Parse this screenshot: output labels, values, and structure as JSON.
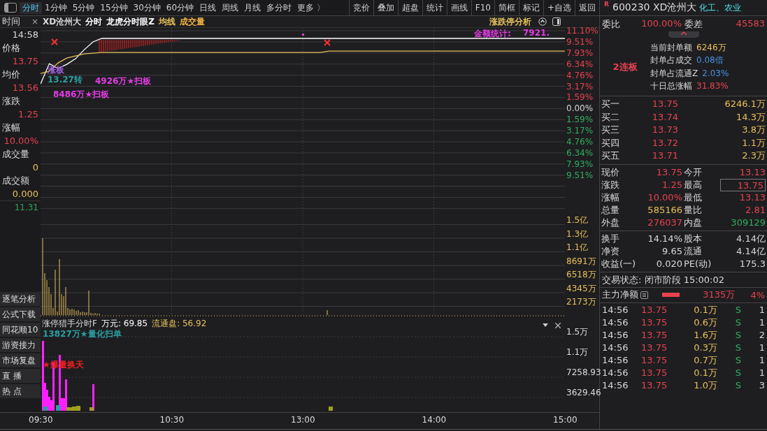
{
  "toolbar": {
    "tabs": [
      {
        "label": "分时",
        "selected": true
      },
      {
        "label": "1分钟",
        "selected": false
      },
      {
        "label": "5分钟",
        "selected": false
      },
      {
        "label": "15分钟",
        "selected": false
      },
      {
        "label": "30分钟",
        "selected": false
      },
      {
        "label": "60分钟",
        "selected": false
      },
      {
        "label": "日线",
        "selected": false
      },
      {
        "label": "周线",
        "selected": false
      },
      {
        "label": "月线",
        "selected": false
      },
      {
        "label": "多分时",
        "selected": false
      },
      {
        "label": "更多 〉",
        "selected": false
      }
    ],
    "buttons": [
      "竞价",
      "叠加",
      "超盘",
      "统计",
      "画线",
      "F10",
      "简框",
      "标记",
      "+自选",
      "返回"
    ]
  },
  "left_panel": {
    "title": "时间",
    "close": "×",
    "fields": [
      {
        "value": "14:58",
        "color": "#d8d8d8"
      },
      {
        "label": "价格",
        "value": "13.75",
        "color": "#e8424f"
      },
      {
        "label": "均价",
        "value": "13.56",
        "color": "#e8424f"
      },
      {
        "label": "涨跌",
        "value": "1.25",
        "color": "#e8424f"
      },
      {
        "label": "涨幅",
        "value": "10.00%",
        "color": "#e8424f"
      },
      {
        "label": "成交量",
        "value": "0",
        "color": "#e6c15a"
      },
      {
        "label": "成交额",
        "value": "0.000",
        "color": "#e6c15a"
      }
    ],
    "low_price": "11.31",
    "side_buttons": [
      "逐笔分析",
      "公式下载",
      "同花顺10",
      "游资接力",
      "市场复盘",
      "直 播",
      "热 点"
    ]
  },
  "chart_header": {
    "items": [
      {
        "text": "XD沧州大",
        "color": "#d8d8d8"
      },
      {
        "text": "分时",
        "color": "#ffffff"
      },
      {
        "text": "龙虎分时眼Z",
        "color": "#ffffff"
      },
      {
        "text": "均线",
        "color": "#e6c15a"
      },
      {
        "text": "成交量",
        "color": "#f0b040"
      }
    ],
    "analysis": "涨跌停分析"
  },
  "price_chart": {
    "chart_data": {
      "type": "line",
      "categories": [
        null,
        null,
        null,
        null,
        null,
        null,
        null,
        null,
        null,
        null,
        null,
        null,
        null,
        null,
        null,
        null,
        null,
        null,
        null,
        null,
        null,
        null,
        null,
        null,
        null,
        null,
        null,
        null,
        null,
        null,
        null,
        null,
        null,
        null,
        null,
        null,
        null,
        null,
        null,
        null,
        null,
        null,
        null,
        null,
        null,
        null,
        null,
        null,
        null,
        null,
        null,
        null,
        null,
        null,
        null,
        null,
        null,
        null,
        null,
        null,
        null
      ],
      "ylim": [
        -11.1,
        11.1
      ],
      "grid": true,
      "series": [
        {
          "color": "#ffffff",
          "values": [
            3.5,
            6.4,
            5.7,
            6.3,
            7.1,
            8.4,
            9.5,
            10.0,
            10.0,
            10.0,
            10.0,
            10.0,
            10.0,
            10.0,
            10.0,
            10.0,
            10.0,
            10.0,
            10.0,
            10.0,
            10.0,
            10.0,
            10.0,
            10.0,
            10.0,
            10.0,
            10.0,
            10.0,
            10.0,
            10.0,
            10.0,
            10.0,
            10.0,
            10.0,
            10.0,
            10.0,
            10.0,
            10.0,
            10.0,
            10.0,
            10.0,
            10.0,
            10.0,
            10.0,
            10.0,
            10.0,
            10.0,
            10.0,
            10.0,
            10.0,
            10.0,
            10.0,
            10.0,
            10.0,
            10.0,
            10.0,
            10.0,
            10.0,
            10.0,
            10.0,
            10.0
          ]
        },
        {
          "color": "#e6c15a",
          "values": [
            5.0,
            5.3,
            6.5,
            7.2,
            7.5,
            7.8,
            7.9,
            8.0,
            8.0,
            8.0,
            8.0,
            8.0,
            8.0,
            8.0,
            8.0,
            8.0,
            8.0,
            8.0,
            8.0,
            8.0,
            8.0,
            8.0,
            8.0,
            8.0,
            8.0,
            8.0,
            8.0,
            8.0,
            8.0,
            8.0,
            8.0,
            8.0,
            8.0,
            8.2,
            8.2,
            8.2,
            8.2,
            8.2,
            8.2,
            8.2,
            8.2,
            8.2,
            8.2,
            8.2,
            8.2,
            8.2,
            8.2,
            8.2,
            8.2,
            8.2,
            8.2,
            8.2,
            8.2,
            8.2,
            8.2,
            8.2,
            8.2,
            8.2,
            8.2,
            8.2,
            8.2
          ]
        }
      ],
      "yticks": [
        {
          "value": 11.1,
          "label": "11.10%"
        },
        {
          "value": 9.51,
          "label": "9.51%"
        },
        {
          "value": 7.93,
          "label": "7.93%"
        },
        {
          "value": 6.34,
          "label": "6.34%"
        },
        {
          "value": 4.76,
          "label": "4.76%"
        },
        {
          "value": 3.17,
          "label": "3.17%"
        },
        {
          "value": 1.59,
          "label": "1.59%"
        },
        {
          "value": 0,
          "label": "0.00%"
        },
        {
          "value": -1.59,
          "label": "1.59%"
        },
        {
          "value": -3.17,
          "label": "3.17%"
        },
        {
          "value": -4.76,
          "label": "4.76%"
        },
        {
          "value": -6.34,
          "label": "6.34%"
        },
        {
          "value": -7.93,
          "label": "7.93%"
        },
        {
          "value": -9.51,
          "label": "9.51%"
        }
      ]
    }
  },
  "volume_axis": [
    "1.5亿",
    "1.3亿",
    "1.1亿",
    "8691万",
    "6518万",
    "4345万",
    "2173万"
  ],
  "annotations": [
    {
      "text": "金额统计:",
      "color": "#e43ce4"
    },
    {
      "text": "7921.",
      "color": "#e43ce4"
    },
    {
      "text": "涨板",
      "color": "#a060e0"
    },
    {
      "text": "13.27转",
      "color": "#2aa0a0"
    },
    {
      "text": "4926万★扫板",
      "color": "#e43ce4"
    },
    {
      "text": "8486万★扫板",
      "color": "#e43ce4"
    }
  ],
  "indicator": {
    "name": "涨停猎手分时F",
    "amount": "万元: 69.85",
    "float_label": "流通盘: 56.92",
    "notes": [
      {
        "text": "13827万★量化扫单",
        "color": "#2aa0a0"
      },
      {
        "text": "★爆量换天",
        "color": "#f02020"
      }
    ],
    "axis": [
      "1.5万",
      "1.1万",
      "7258.93",
      "3629.46"
    ]
  },
  "time_axis": [
    "09:30",
    "10:30",
    "13:00",
    "14:00",
    "15:00"
  ],
  "quote": {
    "mark": "R",
    "code_name": "600230 XD沧州大",
    "sector": "化工、农业",
    "ratio_label": "委比",
    "ratio": "100.00%",
    "diff_label": "委差",
    "diff": "45583",
    "board": "2连板",
    "seal_info": [
      {
        "label": "当前封单额",
        "value": "6246万",
        "color": "#e6c15a"
      },
      {
        "label": "封单占成交",
        "value": "0.08倍",
        "color": "#4a90e0"
      },
      {
        "label": "封单占流通Z",
        "value": "2.03%",
        "color": "#4a90e0"
      },
      {
        "label": "十日总涨幅",
        "value": "31.83%",
        "color": "#e8424f"
      }
    ],
    "bids": [
      {
        "label": "买一",
        "price": "13.75",
        "volume": "6246.1万"
      },
      {
        "label": "买二",
        "price": "13.74",
        "volume": "14.3万"
      },
      {
        "label": "买三",
        "price": "13.73",
        "volume": "3.8万"
      },
      {
        "label": "买四",
        "price": "13.72",
        "volume": "1.1万"
      },
      {
        "label": "买五",
        "price": "13.71",
        "volume": "2.3万"
      }
    ],
    "stats": [
      {
        "label": "现价",
        "value": "13.75",
        "color": "#e8424f",
        "boxed": false
      },
      {
        "label": "今开",
        "value": "13.13",
        "color": "#e8424f",
        "boxed": false
      },
      {
        "label": "涨跌",
        "value": "1.25",
        "color": "#e8424f",
        "boxed": false
      },
      {
        "label": "最高",
        "value": "13.75",
        "color": "#e8424f",
        "boxed": true
      },
      {
        "label": "涨幅",
        "value": "10.00%",
        "color": "#e8424f",
        "boxed": false
      },
      {
        "label": "最低",
        "value": "13.13",
        "color": "#e8424f",
        "boxed": false
      },
      {
        "label": "总量",
        "value": "585166",
        "color": "#e6c15a",
        "boxed": false
      },
      {
        "label": "量比",
        "value": "2.81",
        "color": "#e8424f",
        "boxed": false
      },
      {
        "label": "外盘",
        "value": "276037",
        "color": "#e8424f",
        "boxed": false
      },
      {
        "label": "内盘",
        "value": "309129",
        "color": "#2fb060",
        "boxed": false
      }
    ],
    "fundamentals": [
      {
        "label": "换手",
        "value": "14.14%",
        "label2": "股本",
        "value2": "4.14亿"
      },
      {
        "label": "净资",
        "value": "9.65",
        "label2": "流通",
        "value2": "4.14亿"
      },
      {
        "label": "收益(一)",
        "value": "0.020",
        "label2": "PE(动)",
        "value2": "175.3"
      }
    ],
    "status": "交易状态: 闭市阶段 15:00:02",
    "net_label": "主力净额",
    "net_amount": "3135万",
    "net_pct": "4%",
    "ticks": [
      {
        "time": "14:56",
        "price": "13.75",
        "volume": "0.1万",
        "side": "S",
        "count": "1"
      },
      {
        "time": "14:56",
        "price": "13.75",
        "volume": "0.6万",
        "side": "S",
        "count": "1"
      },
      {
        "time": "14:56",
        "price": "13.75",
        "volume": "1.6万",
        "side": "S",
        "count": "2"
      },
      {
        "time": "14:56",
        "price": "13.75",
        "volume": "0.3万",
        "side": "S",
        "count": "1"
      },
      {
        "time": "14:56",
        "price": "13.75",
        "volume": "0.7万",
        "side": "S",
        "count": "1"
      },
      {
        "time": "14:56",
        "price": "13.75",
        "volume": "0.1万",
        "side": "S",
        "count": "1"
      },
      {
        "time": "14:56",
        "price": "13.75",
        "volume": "1.0万",
        "side": "S",
        "count": "3"
      }
    ]
  }
}
